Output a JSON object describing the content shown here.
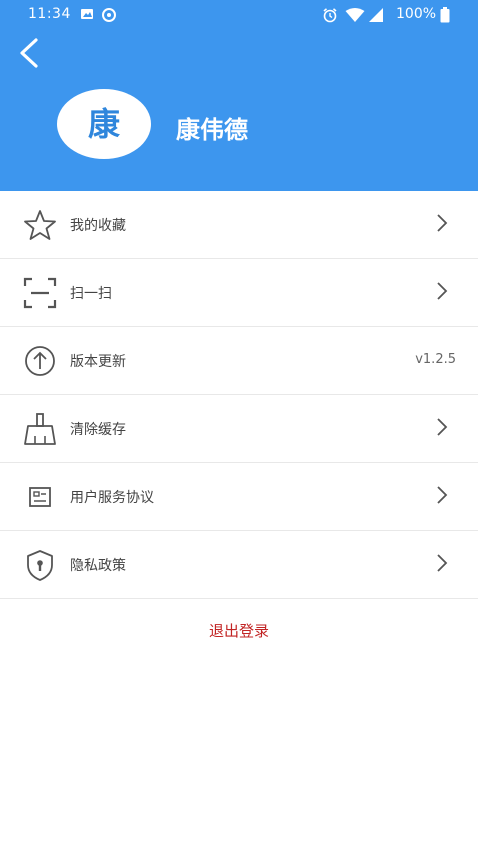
{
  "status_bar": {
    "time": "11:34",
    "battery": "100%"
  },
  "profile": {
    "avatar_char": "康",
    "name": "康伟德"
  },
  "menu": [
    {
      "label": "我的收藏",
      "icon": "star-icon",
      "value": ""
    },
    {
      "label": "扫一扫",
      "icon": "scan-icon",
      "value": ""
    },
    {
      "label": "版本更新",
      "icon": "upload-circle-icon",
      "value": "v1.2.5"
    },
    {
      "label": "清除缓存",
      "icon": "broom-icon",
      "value": ""
    },
    {
      "label": "用户服务协议",
      "icon": "document-icon",
      "value": ""
    },
    {
      "label": "隐私政策",
      "icon": "shield-lock-icon",
      "value": ""
    }
  ],
  "logout_label": "退出登录",
  "colors": {
    "header_bg": "#3d96ee",
    "logout": "#c22424"
  }
}
